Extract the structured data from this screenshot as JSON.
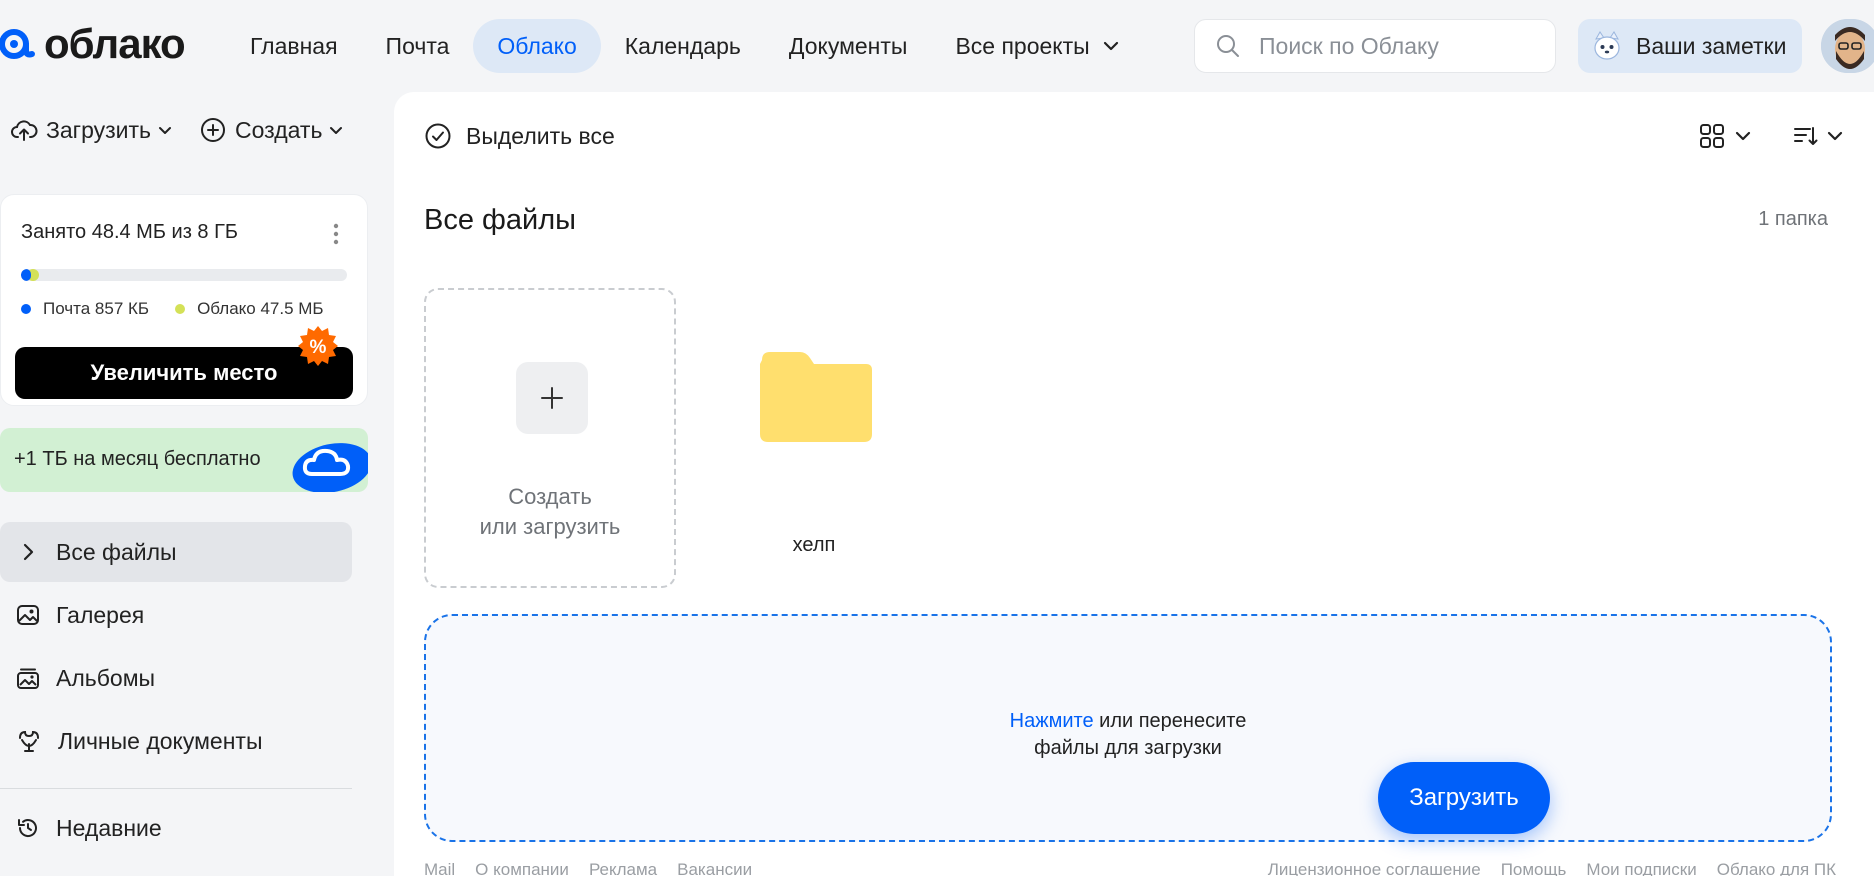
{
  "header": {
    "logo_text": "облако",
    "nav": [
      {
        "label": "Главная",
        "active": false
      },
      {
        "label": "Почта",
        "active": false
      },
      {
        "label": "Облако",
        "active": true
      },
      {
        "label": "Календарь",
        "active": false
      },
      {
        "label": "Документы",
        "active": false
      },
      {
        "label": "Все проекты",
        "active": false
      }
    ],
    "search_placeholder": "Поиск по Облаку",
    "notes_label": "Ваши заметки"
  },
  "sidebar": {
    "upload_label": "Загрузить",
    "create_label": "Создать",
    "storage": {
      "title": "Занято 48.4 МБ из 8 ГБ",
      "mail_label": "Почта 857 КБ",
      "cloud_label": "Облако 47.5 МБ",
      "mail_fraction": 0.0001,
      "cloud_fraction": 0.0058
    },
    "upgrade_label": "Увеличить место",
    "promo_badge": "%",
    "promo_text": "+1 ТБ на месяц бесплатно",
    "menu": [
      {
        "label": "Все файлы",
        "icon": "chevron-right-icon",
        "active": true
      },
      {
        "label": "Галерея",
        "icon": "image-icon",
        "active": false
      },
      {
        "label": "Альбомы",
        "icon": "album-icon",
        "active": false
      },
      {
        "label": "Личные документы",
        "icon": "documents-icon",
        "active": false
      }
    ],
    "recent_label": "Недавние"
  },
  "main": {
    "select_all_label": "Выделить все",
    "title": "Все файлы",
    "count": "1 папка",
    "create_tile_line1": "Создать",
    "create_tile_line2": "или загрузить",
    "folders": [
      {
        "name": "хелп"
      }
    ],
    "drop_link": "Нажмите",
    "drop_text_1": " или перенесите",
    "drop_text_2": "файлы для загрузки",
    "upload_button": "Загрузить",
    "footer_left": [
      "Mail",
      "О компании",
      "Реклама",
      "Вакансии"
    ],
    "footer_right": [
      "Лицензионное соглашение",
      "Помощь",
      "Мои подписки",
      "Облако для ПК"
    ]
  },
  "colors": {
    "accent": "#005ff9",
    "nav_active_bg": "#dde8f6",
    "folder": "#ffdf6e",
    "promo_bg": "#d2f0d3",
    "cloud_bar": "#d4e157",
    "badge": "#ff6a00"
  }
}
